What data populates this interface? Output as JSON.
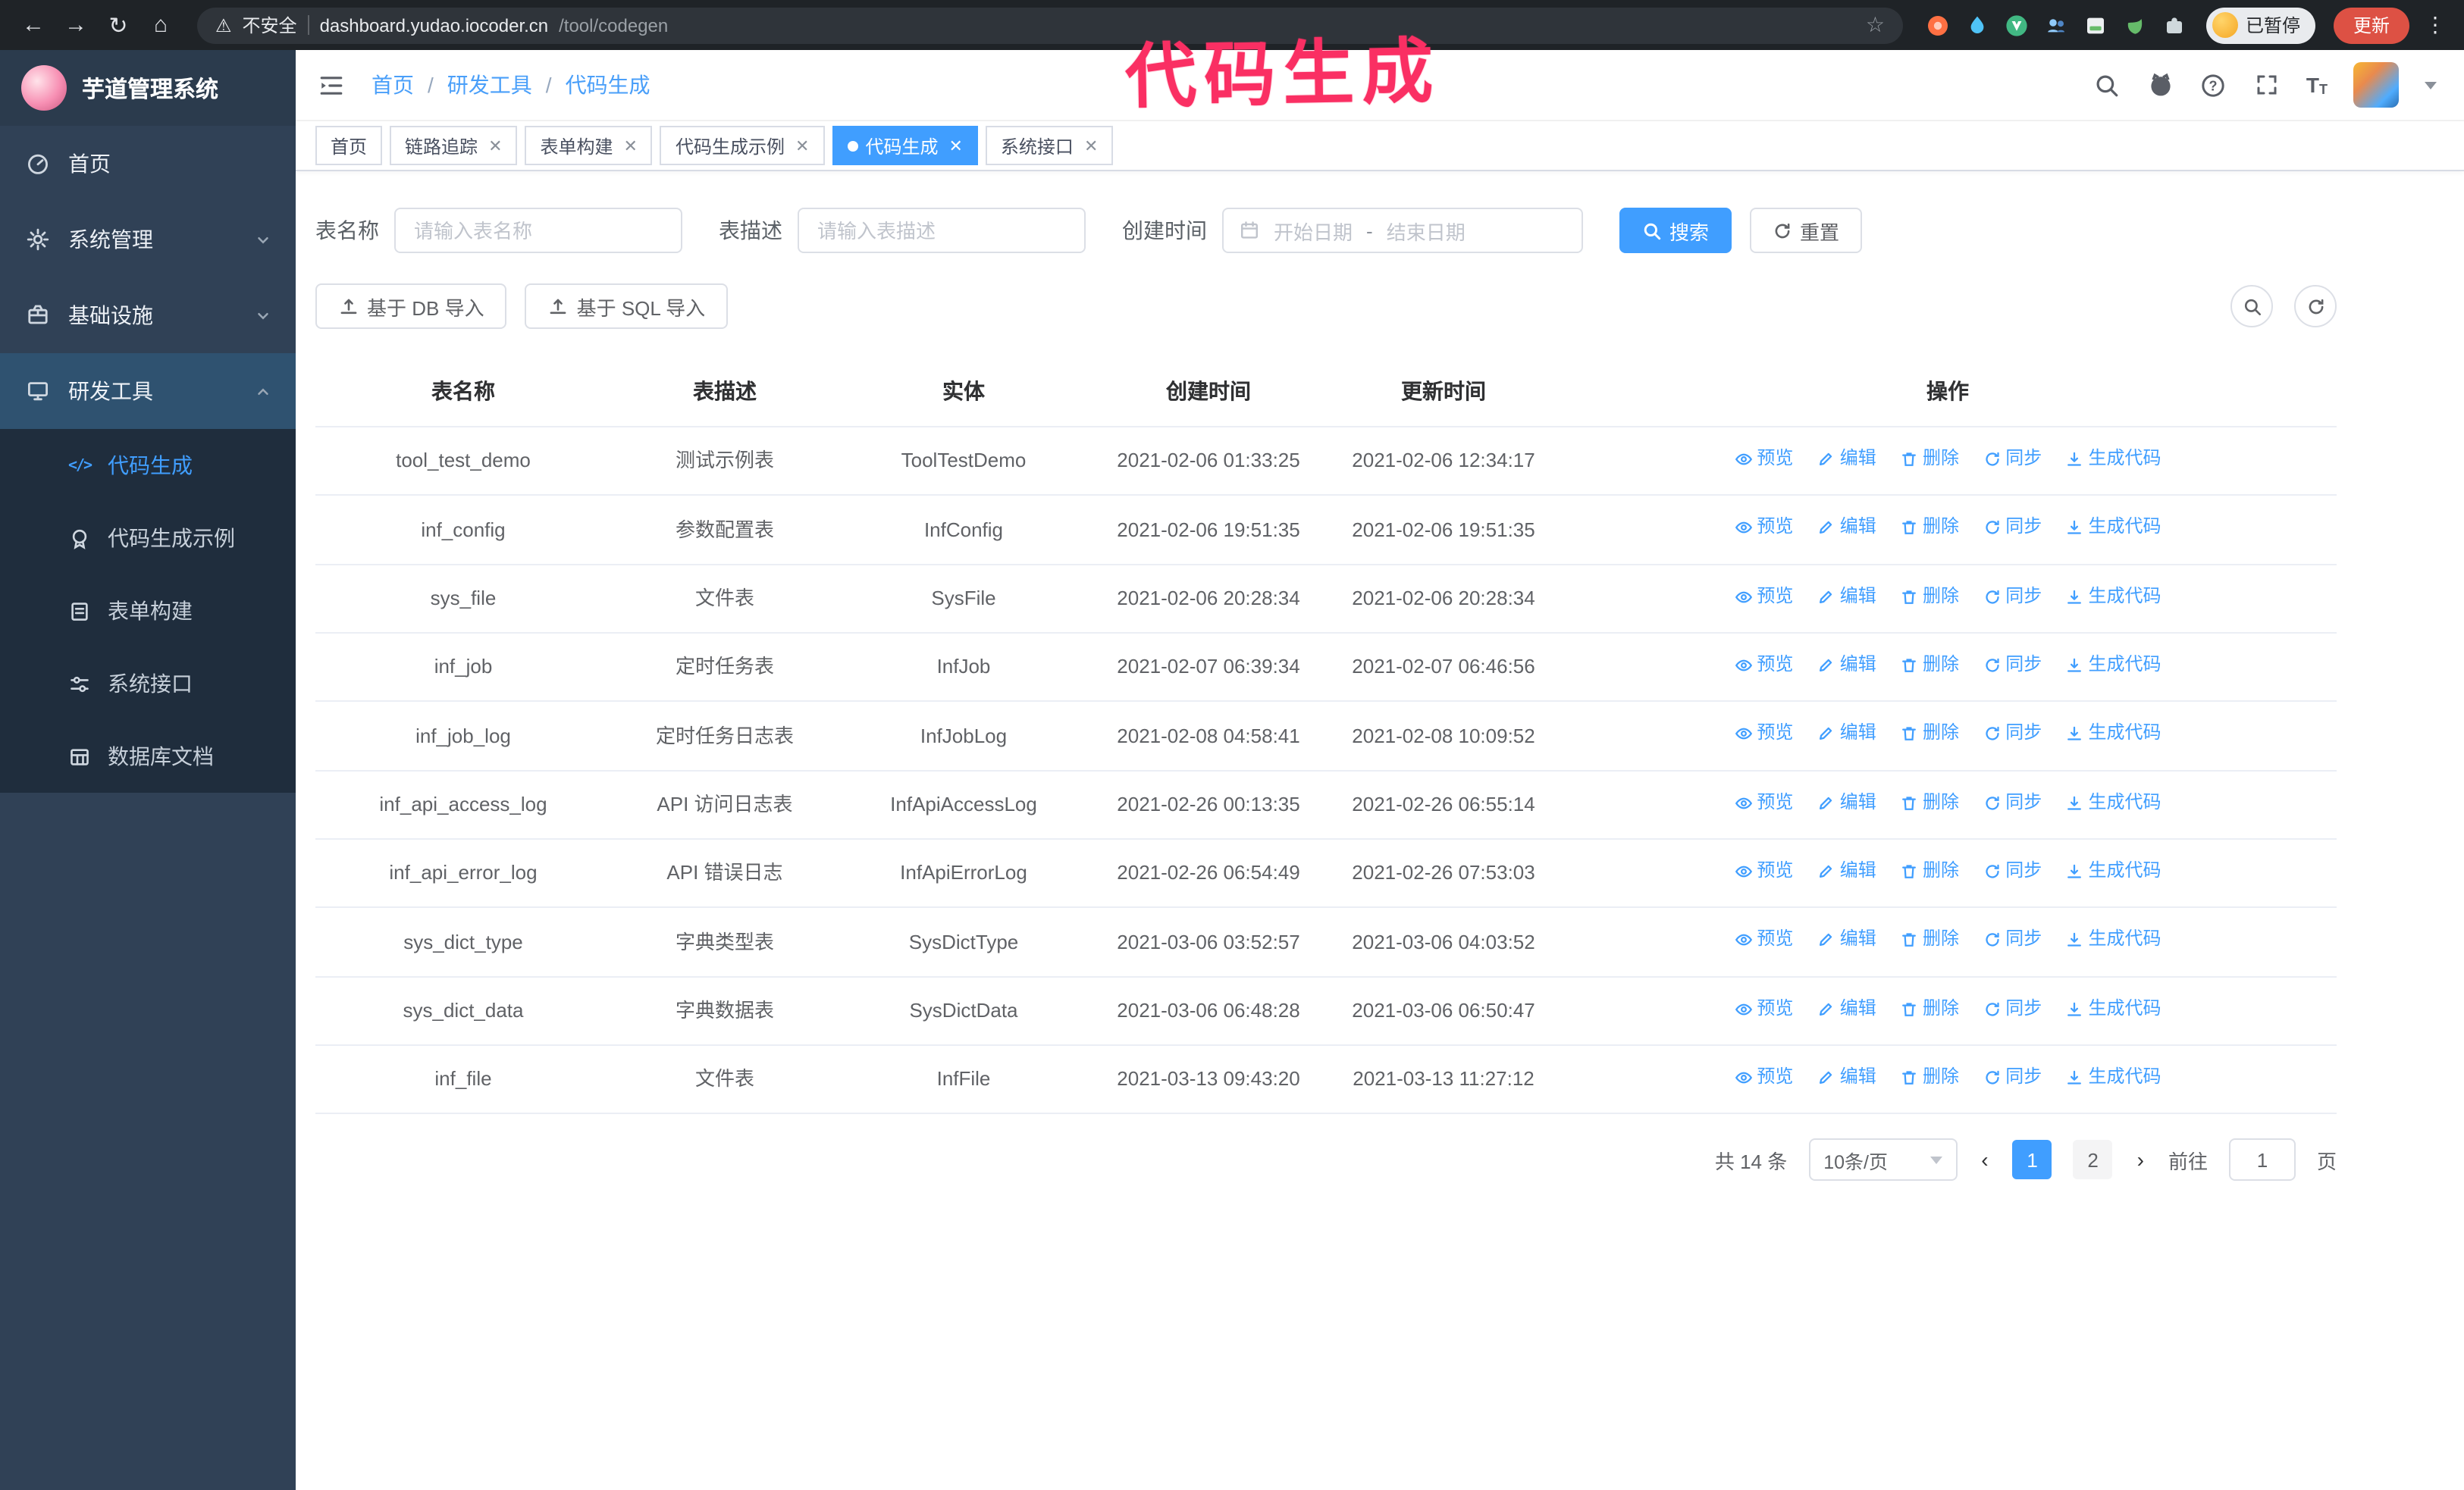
{
  "browser": {
    "security_label": "不安全",
    "url_host": "dashboard.yudao.iocoder.cn",
    "url_path": "/tool/codegen",
    "profile_chip_label": "已暂停",
    "update_button_label": "更新"
  },
  "annotation": {
    "text": "代码生成"
  },
  "colors": {
    "accent": "#409EFF",
    "annotation": "#fa2f63",
    "sidebar_bg": "#304156",
    "submenu_bg": "#1f2d3d",
    "tab_active_bg": "#409EFF"
  },
  "sidebar": {
    "logo_title": "芋道管理系统",
    "items": [
      {
        "label": "首页"
      },
      {
        "label": "系统管理"
      },
      {
        "label": "基础设施"
      },
      {
        "label": "研发工具"
      }
    ],
    "sub_items": [
      {
        "label": "代码生成"
      },
      {
        "label": "代码生成示例"
      },
      {
        "label": "表单构建"
      },
      {
        "label": "系统接口"
      },
      {
        "label": "数据库文档"
      }
    ]
  },
  "breadcrumb": {
    "items": [
      "首页",
      "研发工具",
      "代码生成"
    ]
  },
  "tabs": [
    {
      "label": "首页"
    },
    {
      "label": "链路追踪"
    },
    {
      "label": "表单构建"
    },
    {
      "label": "代码生成示例"
    },
    {
      "label": "代码生成"
    },
    {
      "label": "系统接口"
    }
  ],
  "filters": {
    "name_label": "表名称",
    "name_placeholder": "请输入表名称",
    "desc_label": "表描述",
    "desc_placeholder": "请输入表描述",
    "time_label": "创建时间",
    "start_placeholder": "开始日期",
    "range_separator": "-",
    "end_placeholder": "结束日期",
    "search_button": "搜索",
    "reset_button": "重置"
  },
  "toolbar": {
    "import_db_button": "基于 DB 导入",
    "import_sql_button": "基于 SQL 导入"
  },
  "table": {
    "columns": [
      "表名称",
      "表描述",
      "实体",
      "创建时间",
      "更新时间",
      "操作"
    ],
    "actions": [
      "预览",
      "编辑",
      "删除",
      "同步",
      "生成代码"
    ],
    "rows": [
      {
        "name": "tool_test_demo",
        "desc": "测试示例表",
        "entity": "ToolTestDemo",
        "created": "2021-02-06 01:33:25",
        "updated": "2021-02-06 12:34:17"
      },
      {
        "name": "inf_config",
        "desc": "参数配置表",
        "entity": "InfConfig",
        "created": "2021-02-06 19:51:35",
        "updated": "2021-02-06 19:51:35"
      },
      {
        "name": "sys_file",
        "desc": "文件表",
        "entity": "SysFile",
        "created": "2021-02-06 20:28:34",
        "updated": "2021-02-06 20:28:34"
      },
      {
        "name": "inf_job",
        "desc": "定时任务表",
        "entity": "InfJob",
        "created": "2021-02-07 06:39:34",
        "updated": "2021-02-07 06:46:56"
      },
      {
        "name": "inf_job_log",
        "desc": "定时任务日志表",
        "entity": "InfJobLog",
        "created": "2021-02-08 04:58:41",
        "updated": "2021-02-08 10:09:52"
      },
      {
        "name": "inf_api_access_log",
        "desc": "API 访问日志表",
        "entity": "InfApiAccessLog",
        "created": "2021-02-26 00:13:35",
        "updated": "2021-02-26 06:55:14"
      },
      {
        "name": "inf_api_error_log",
        "desc": "API 错误日志",
        "entity": "InfApiErrorLog",
        "created": "2021-02-26 06:54:49",
        "updated": "2021-02-26 07:53:03"
      },
      {
        "name": "sys_dict_type",
        "desc": "字典类型表",
        "entity": "SysDictType",
        "created": "2021-03-06 03:52:57",
        "updated": "2021-03-06 04:03:52"
      },
      {
        "name": "sys_dict_data",
        "desc": "字典数据表",
        "entity": "SysDictData",
        "created": "2021-03-06 06:48:28",
        "updated": "2021-03-06 06:50:47"
      },
      {
        "name": "inf_file",
        "desc": "文件表",
        "entity": "InfFile",
        "created": "2021-03-13 09:43:20",
        "updated": "2021-03-13 11:27:12"
      }
    ]
  },
  "pagination": {
    "total_text": "共 14 条",
    "page_size_text": "10条/页",
    "pages": [
      "1",
      "2"
    ],
    "goto_label": "前往",
    "goto_value": "1",
    "unit_label": "页"
  }
}
